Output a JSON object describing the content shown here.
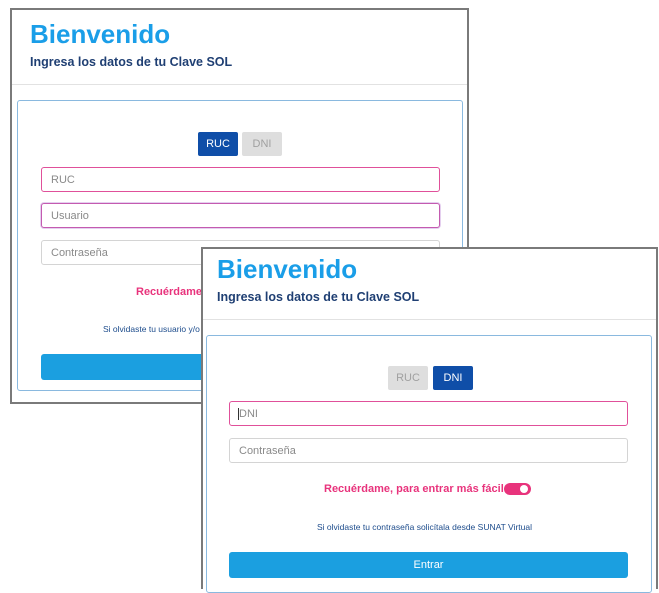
{
  "back_panel": {
    "title": "Bienvenido",
    "subtitle": "Ingresa los datos de tu Clave SOL",
    "tabs": [
      {
        "label": "RUC",
        "active": true
      },
      {
        "label": "DNI",
        "active": false
      }
    ],
    "ruc_placeholder": "RUC",
    "user_placeholder": "Usuario",
    "password_placeholder": "Contraseña",
    "remember_text": "Recuérdame,",
    "forgot_text": "Si olvidaste tu usuario y/o"
  },
  "front_panel": {
    "title": "Bienvenido",
    "subtitle": "Ingresa los datos de tu Clave SOL",
    "tabs": [
      {
        "label": "RUC",
        "active": false
      },
      {
        "label": "DNI",
        "active": true
      }
    ],
    "dni_placeholder": "DNI",
    "password_placeholder": "Contraseña",
    "remember_text": "Recuérdame, para entrar más fácil",
    "remember_toggle_on": true,
    "forgot_text": "Si olvidaste tu contraseña solicítala desde SUNAT Virtual",
    "submit_label": "Entrar"
  },
  "colors": {
    "title_blue": "#1a9ee8",
    "subtitle_navy": "#1f3f73",
    "tab_active": "#0f4ea8",
    "button_blue": "#1b9fe0",
    "accent_pink": "#e8337c"
  }
}
